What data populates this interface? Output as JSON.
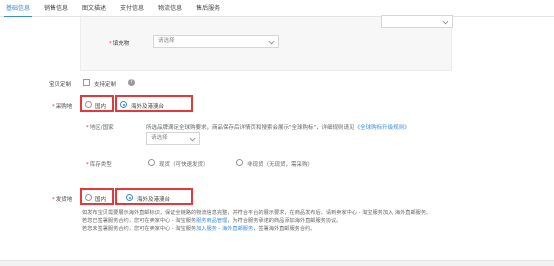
{
  "tabs": [
    "基础信息",
    "销售信息",
    "图文描述",
    "支付信息",
    "物流信息",
    "售后服务"
  ],
  "top_section": {
    "partial_select_text": "",
    "fill_label": "填充物",
    "fill_placeholder": "请选择"
  },
  "custom": {
    "label": "宝贝定制",
    "checkbox_label": "支持定制"
  },
  "purchase": {
    "label": "采购地",
    "options": [
      "国内",
      "海外及港澳台"
    ],
    "selected": "海外及港澳台",
    "region_label": "地区/国家",
    "region_note": "所选品牌满足全球购要求，商品保存后详情页和搜索会展示\"全球购标\"，详细规则请见",
    "region_link": "《全球购标升级规则》",
    "region_placeholder": "请选择",
    "stock_label": "库存类型",
    "stock_options": [
      "现货（可快速发货）",
      "非现货（无现货，需采购）"
    ]
  },
  "shipping": {
    "label": "发货地",
    "options": [
      "国内",
      "海外及港澳台"
    ],
    "selected": "海外及港澳台",
    "note_line1": "如发布宝贝需要展示海外直邮标识，保证全链路的物流信息完整，并符合平台的展示要求，在商品发布后，请到卖家中心 - 淘宝服务加入 海外直邮服务。",
    "note_line2_a": "若您已签署服务合约，您可在卖家中心 - 淘宝服务",
    "note_line2_link": "服务商品管理",
    "note_line2_b": "，为符合服务承诺的商品添加海外直邮服务协议。",
    "note_line3_a": "若您未签署服务合约，您可在卖家中心 - 淘宝服务",
    "note_line3_link": "加入服务 - 海外直邮服务",
    "note_line3_b": "，签署海外直邮服务合约。"
  }
}
